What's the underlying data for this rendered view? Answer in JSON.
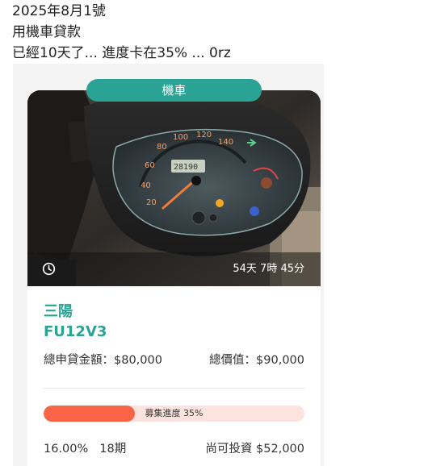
{
  "post": {
    "line1": "2025年8月1號",
    "line2": "用機車貸款",
    "line3": "已經10天了... 進度卡在35% ... 0rz"
  },
  "card": {
    "category": "機車",
    "timer": "54天 7時 45分",
    "brand": "三陽",
    "model": "FU12V3",
    "loan_amount": "總申貸金額：$80,000",
    "total_value": "總價值：$90,000",
    "progress": {
      "label": "募集進度 35%",
      "percent": 35
    },
    "rate": "16.00%",
    "term": "18期",
    "investable": "尚可投資 $52,000"
  },
  "colors": {
    "accent": "#2aa294",
    "progress_fill": "#fa6446",
    "progress_track": "#fde3dd"
  },
  "icons": {
    "timer": "clock-icon"
  }
}
